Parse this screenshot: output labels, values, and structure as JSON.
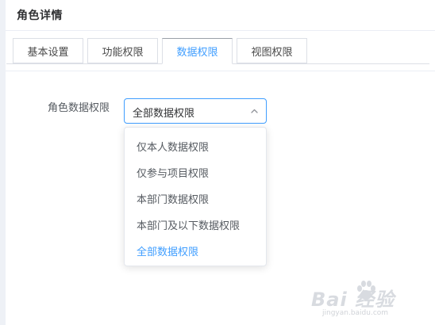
{
  "header": {
    "title": "角色详情"
  },
  "tabs": [
    {
      "label": "基本设置",
      "active": false
    },
    {
      "label": "功能权限",
      "active": false
    },
    {
      "label": "数据权限",
      "active": true
    },
    {
      "label": "视图权限",
      "active": false
    }
  ],
  "form": {
    "label": "角色数据权限",
    "select": {
      "value": "全部数据权限",
      "open": true,
      "options": [
        "仅本人数据权限",
        "仅参与项目权限",
        "本部门数据权限",
        "本部门及以下数据权限",
        "全部数据权限"
      ],
      "selected_index": 4
    }
  },
  "watermark": {
    "text": "Bai 经验",
    "sub": "jingyan.baidu.com"
  },
  "colors": {
    "accent": "#409eff",
    "text": "#303133",
    "border": "#dcdfe6"
  }
}
